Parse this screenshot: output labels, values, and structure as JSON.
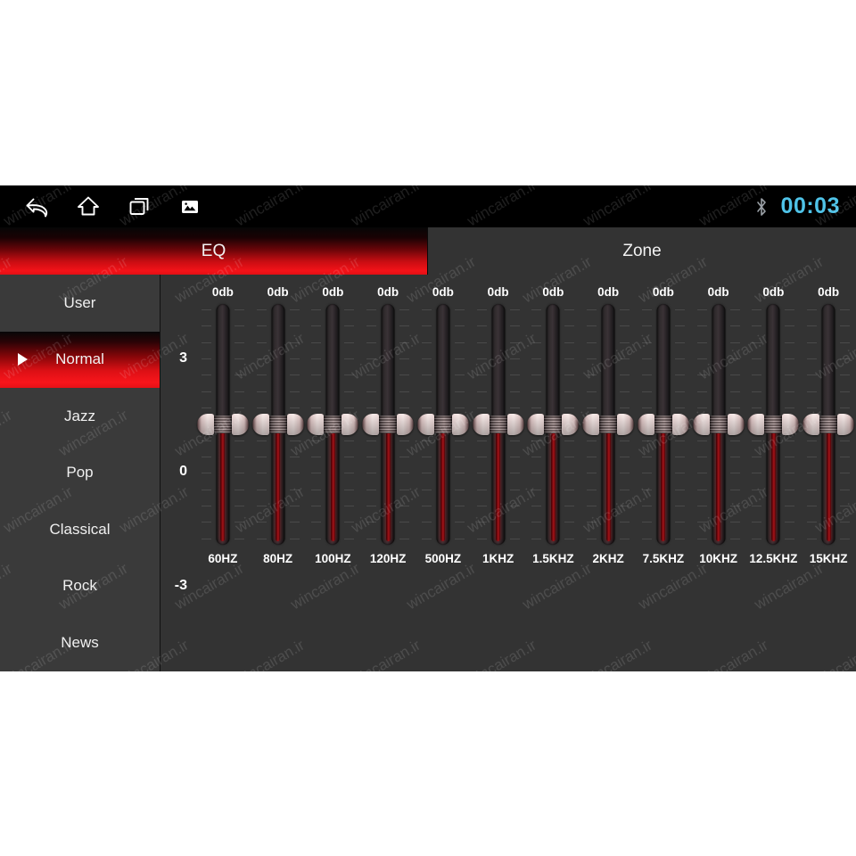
{
  "statusbar": {
    "nav": [
      {
        "name": "back-icon",
        "label": "Back"
      },
      {
        "name": "home-icon",
        "label": "Home"
      },
      {
        "name": "recents-icon",
        "label": "Recent apps"
      },
      {
        "name": "screenshot-icon",
        "label": "Screenshot"
      }
    ],
    "bluetooth_label": "Bluetooth",
    "clock": "00:03",
    "clock_color": "#4fc3e8",
    "background": "#000000"
  },
  "tabs": {
    "active_index": 0,
    "items": [
      {
        "label": "EQ",
        "active": true
      },
      {
        "label": "Zone",
        "active": false
      }
    ],
    "active_color": "#e71116",
    "inactive_color": "#333333"
  },
  "sidebar": {
    "selected": "Normal",
    "items": [
      {
        "label": "User",
        "selected": false
      },
      {
        "label": "Normal",
        "selected": true
      },
      {
        "label": "Jazz",
        "selected": false
      },
      {
        "label": "Pop",
        "selected": false
      },
      {
        "label": "Classical",
        "selected": false
      },
      {
        "label": "Rock",
        "selected": false
      },
      {
        "label": "News",
        "selected": false
      }
    ]
  },
  "equalizer": {
    "scale_labels": {
      "top": "3",
      "middle": "0",
      "bottom": "-3"
    },
    "range_db": [
      -3,
      3
    ],
    "unit": "db",
    "bands": [
      {
        "freq": "60HZ",
        "value": "0db",
        "gain": 0
      },
      {
        "freq": "80HZ",
        "value": "0db",
        "gain": 0
      },
      {
        "freq": "100HZ",
        "value": "0db",
        "gain": 0
      },
      {
        "freq": "120HZ",
        "value": "0db",
        "gain": 0
      },
      {
        "freq": "500HZ",
        "value": "0db",
        "gain": 0
      },
      {
        "freq": "1KHZ",
        "value": "0db",
        "gain": 0
      },
      {
        "freq": "1.5KHZ",
        "value": "0db",
        "gain": 0
      },
      {
        "freq": "2KHZ",
        "value": "0db",
        "gain": 0
      },
      {
        "freq": "7.5KHZ",
        "value": "0db",
        "gain": 0
      },
      {
        "freq": "10KHZ",
        "value": "0db",
        "gain": 0
      },
      {
        "freq": "12.5KHZ",
        "value": "0db",
        "gain": 0
      },
      {
        "freq": "15KHZ",
        "value": "0db",
        "gain": 0
      }
    ]
  },
  "watermark": {
    "text": "wincairan.ir"
  }
}
